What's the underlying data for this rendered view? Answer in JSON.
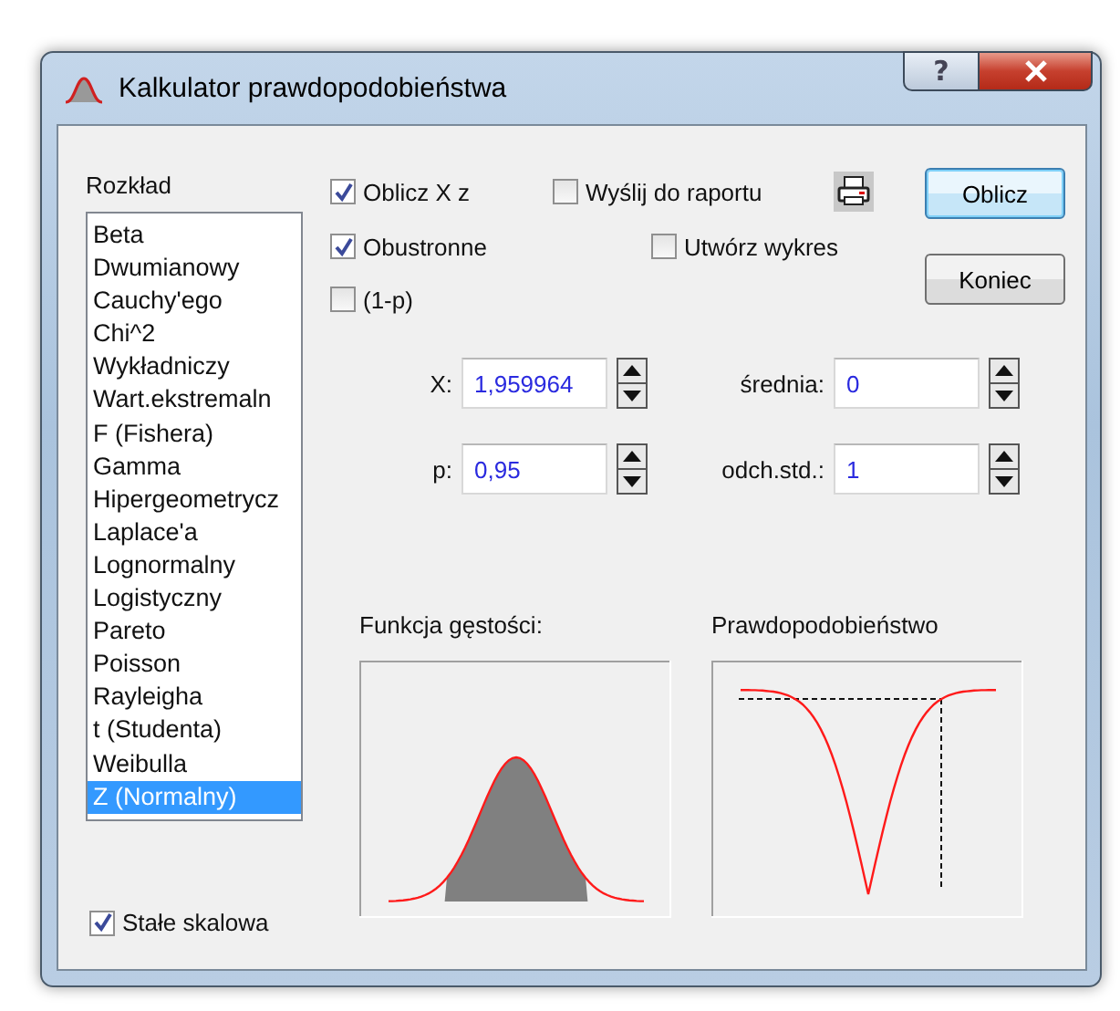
{
  "window": {
    "title": "Kalkulator prawdopodobieństwa",
    "help_button": "?"
  },
  "distribution": {
    "label": "Rozkład",
    "items": [
      {
        "label": "Beta",
        "selected": false
      },
      {
        "label": "Dwumianowy",
        "selected": false
      },
      {
        "label": "Cauchy'ego",
        "selected": false
      },
      {
        "label": "Chi^2",
        "selected": false
      },
      {
        "label": "Wykładniczy",
        "selected": false
      },
      {
        "label": "Wart.ekstremaln",
        "selected": false
      },
      {
        "label": "F (Fishera)",
        "selected": false
      },
      {
        "label": "Gamma",
        "selected": false
      },
      {
        "label": "Hipergeometrycz",
        "selected": false
      },
      {
        "label": "Laplace'a",
        "selected": false
      },
      {
        "label": "Lognormalny",
        "selected": false
      },
      {
        "label": "Logistyczny",
        "selected": false
      },
      {
        "label": "Pareto",
        "selected": false
      },
      {
        "label": "Poisson",
        "selected": false
      },
      {
        "label": "Rayleigha",
        "selected": false
      },
      {
        "label": "t (Studenta)",
        "selected": false
      },
      {
        "label": "Weibulla",
        "selected": false
      },
      {
        "label": "Z (Normalny)",
        "selected": true
      }
    ]
  },
  "options": [
    {
      "label": "Oblicz X z",
      "checked": true
    },
    {
      "label": "Wyślij do raportu",
      "checked": false
    },
    {
      "label": "Obustronne",
      "checked": true
    },
    {
      "label": "Utwórz wykres",
      "checked": false
    },
    {
      "label": "(1-p)",
      "checked": false
    }
  ],
  "buttons": [
    {
      "label": "Oblicz",
      "default": true
    },
    {
      "label": "Koniec",
      "default": false
    }
  ],
  "fields": [
    {
      "label": "X:",
      "value": "1,959964"
    },
    {
      "label": "średnia:",
      "value": "0"
    },
    {
      "label": "p:",
      "value": "0,95"
    },
    {
      "label": "odch.std.:",
      "value": "1"
    }
  ],
  "plots": [
    {
      "title": "Funkcja gęstości:",
      "kind": "density"
    },
    {
      "title": "Prawdopodobieństwo",
      "kind": "probability"
    }
  ],
  "fixed_scale": {
    "label": "Stałe skalowa",
    "checked": true
  }
}
